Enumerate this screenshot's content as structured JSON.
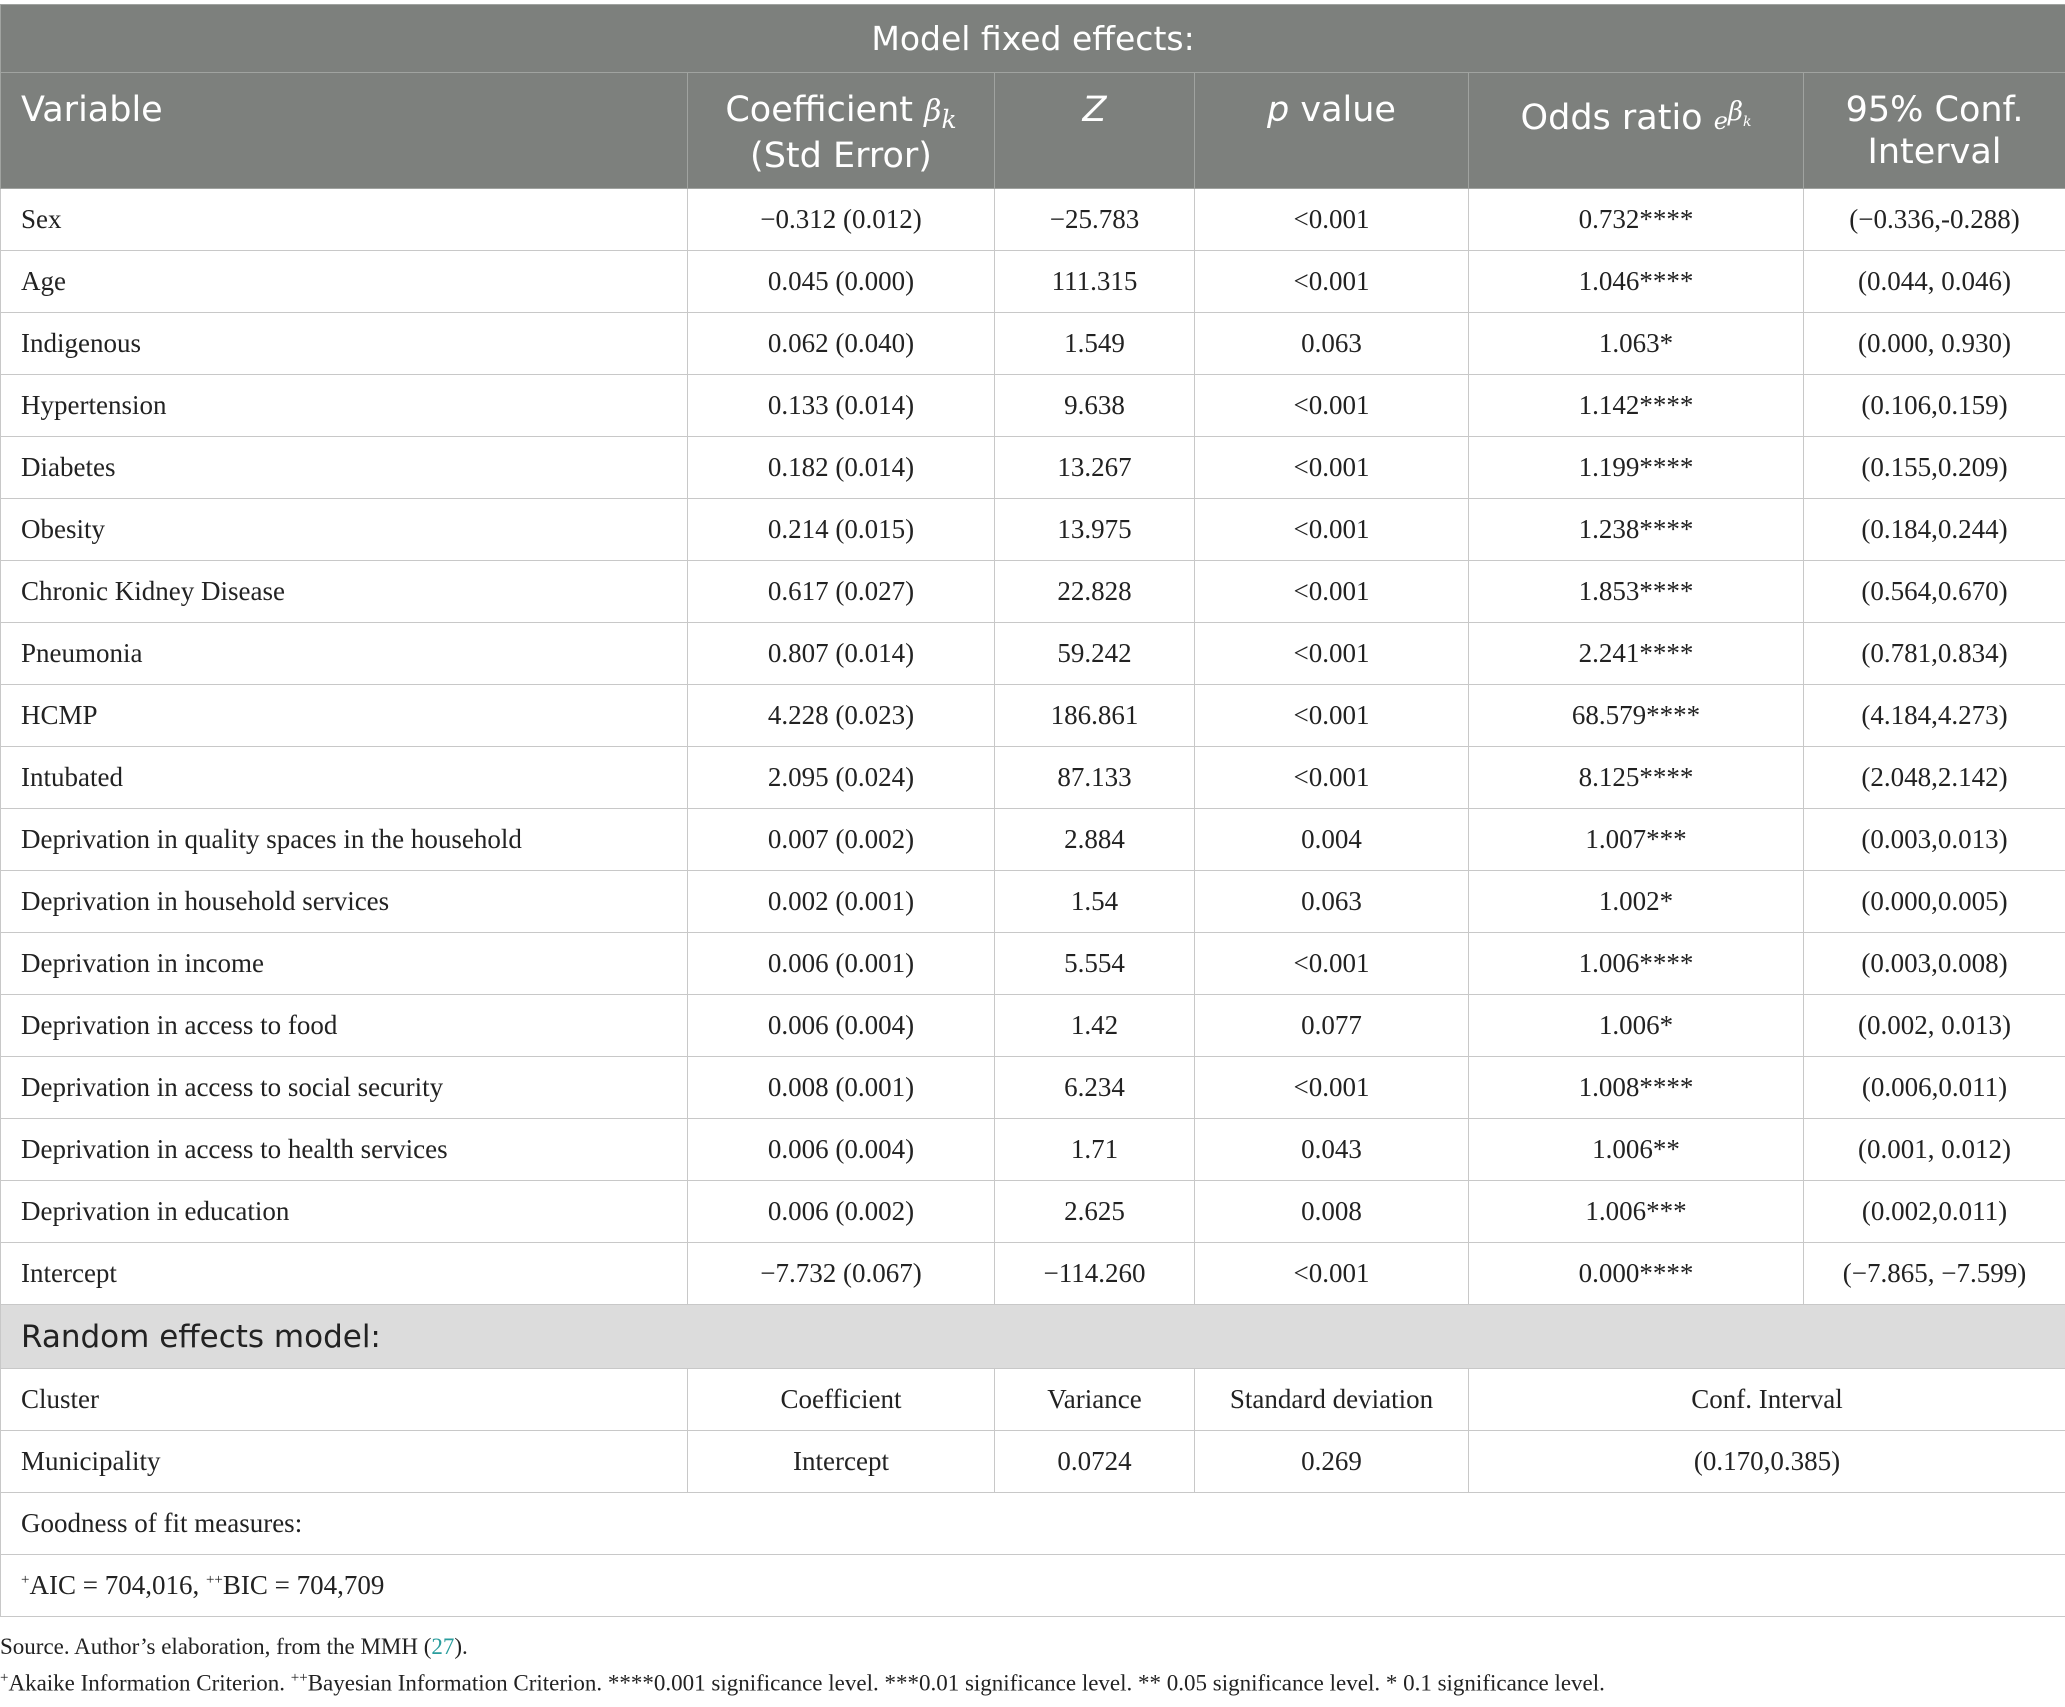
{
  "table": {
    "title": "Model fixed effects:",
    "headers": {
      "variable": "Variable",
      "coef_line1": "Coefficient",
      "coef_symbol": "βk",
      "coef_line2": "(Std Error)",
      "z": "Z",
      "p_italic": "p",
      "p_rest": " value",
      "odds": "Odds ratio",
      "odds_symbol": "eβk",
      "ci": "95% Conf. Interval"
    },
    "rows": [
      {
        "variable": "Sex",
        "coef": "−0.312 (0.012)",
        "z": "−25.783",
        "p": "<0.001",
        "or": "0.732****",
        "ci": "(−0.336,-0.288)"
      },
      {
        "variable": "Age",
        "coef": "0.045 (0.000)",
        "z": "111.315",
        "p": "<0.001",
        "or": "1.046****",
        "ci": "(0.044, 0.046)"
      },
      {
        "variable": "Indigenous",
        "coef": "0.062 (0.040)",
        "z": "1.549",
        "p": "0.063",
        "or": "1.063*",
        "ci": "(0.000, 0.930)"
      },
      {
        "variable": "Hypertension",
        "coef": "0.133 (0.014)",
        "z": "9.638",
        "p": "<0.001",
        "or": "1.142****",
        "ci": "(0.106,0.159)"
      },
      {
        "variable": "Diabetes",
        "coef": "0.182 (0.014)",
        "z": "13.267",
        "p": "<0.001",
        "or": "1.199****",
        "ci": "(0.155,0.209)"
      },
      {
        "variable": "Obesity",
        "coef": "0.214 (0.015)",
        "z": "13.975",
        "p": "<0.001",
        "or": "1.238****",
        "ci": "(0.184,0.244)"
      },
      {
        "variable": "Chronic Kidney Disease",
        "coef": "0.617 (0.027)",
        "z": "22.828",
        "p": "<0.001",
        "or": "1.853****",
        "ci": "(0.564,0.670)"
      },
      {
        "variable": "Pneumonia",
        "coef": "0.807 (0.014)",
        "z": "59.242",
        "p": "<0.001",
        "or": "2.241****",
        "ci": "(0.781,0.834)"
      },
      {
        "variable": "HCMP",
        "coef": "4.228 (0.023)",
        "z": "186.861",
        "p": "<0.001",
        "or": "68.579****",
        "ci": "(4.184,4.273)"
      },
      {
        "variable": "Intubated",
        "coef": "2.095 (0.024)",
        "z": "87.133",
        "p": "<0.001",
        "or": "8.125****",
        "ci": "(2.048,2.142)"
      },
      {
        "variable": "Deprivation in quality spaces in the household",
        "coef": "0.007 (0.002)",
        "z": "2.884",
        "p": "0.004",
        "or": "1.007***",
        "ci": "(0.003,0.013)"
      },
      {
        "variable": "Deprivation in household services",
        "coef": "0.002 (0.001)",
        "z": "1.54",
        "p": "0.063",
        "or": "1.002*",
        "ci": "(0.000,0.005)"
      },
      {
        "variable": "Deprivation in income",
        "coef": "0.006 (0.001)",
        "z": "5.554",
        "p": "<0.001",
        "or": "1.006****",
        "ci": "(0.003,0.008)"
      },
      {
        "variable": "Deprivation in access to food",
        "coef": "0.006 (0.004)",
        "z": "1.42",
        "p": "0.077",
        "or": "1.006*",
        "ci": "(0.002, 0.013)"
      },
      {
        "variable": "Deprivation in access to social security",
        "coef": "0.008 (0.001)",
        "z": "6.234",
        "p": "<0.001",
        "or": "1.008****",
        "ci": "(0.006,0.011)"
      },
      {
        "variable": "Deprivation in access to health services",
        "coef": "0.006 (0.004)",
        "z": "1.71",
        "p": "0.043",
        "or": "1.006**",
        "ci": "(0.001, 0.012)"
      },
      {
        "variable": "Deprivation in education",
        "coef": "0.006 (0.002)",
        "z": "2.625",
        "p": "0.008",
        "or": "1.006***",
        "ci": "(0.002,0.011)"
      },
      {
        "variable": "Intercept",
        "coef": "−7.732 (0.067)",
        "z": "−114.260",
        "p": "<0.001",
        "or": "0.000****",
        "ci": "(−7.865, −7.599)"
      }
    ],
    "random": {
      "title": "Random effects model:",
      "header": {
        "cluster": "Cluster",
        "coefficient": "Coefficient",
        "variance": "Variance",
        "sd": "Standard deviation",
        "ci": "Conf. Interval"
      },
      "row": {
        "cluster": "Municipality",
        "coefficient": "Intercept",
        "variance": "0.0724",
        "sd": "0.269",
        "ci": "(0.170,0.385)"
      }
    },
    "fit": {
      "label": "Goodness of fit measures:",
      "aic_mark": "+",
      "aic": "AIC = 704,016, ",
      "bic_mark": "++",
      "bic": "BIC = 704,709"
    }
  },
  "footnotes": {
    "source_pre": "Source. Author’s elaboration, from the MMH (",
    "source_ref": "27",
    "source_post": ").",
    "legend_mark1": "+",
    "legend_text1": "Akaike Information Criterion. ",
    "legend_mark2": "++",
    "legend_text2": "Bayesian Information Criterion. ****0.001 significance level. ***0.01 significance level. ** 0.05 significance level. * 0.1 significance level."
  }
}
